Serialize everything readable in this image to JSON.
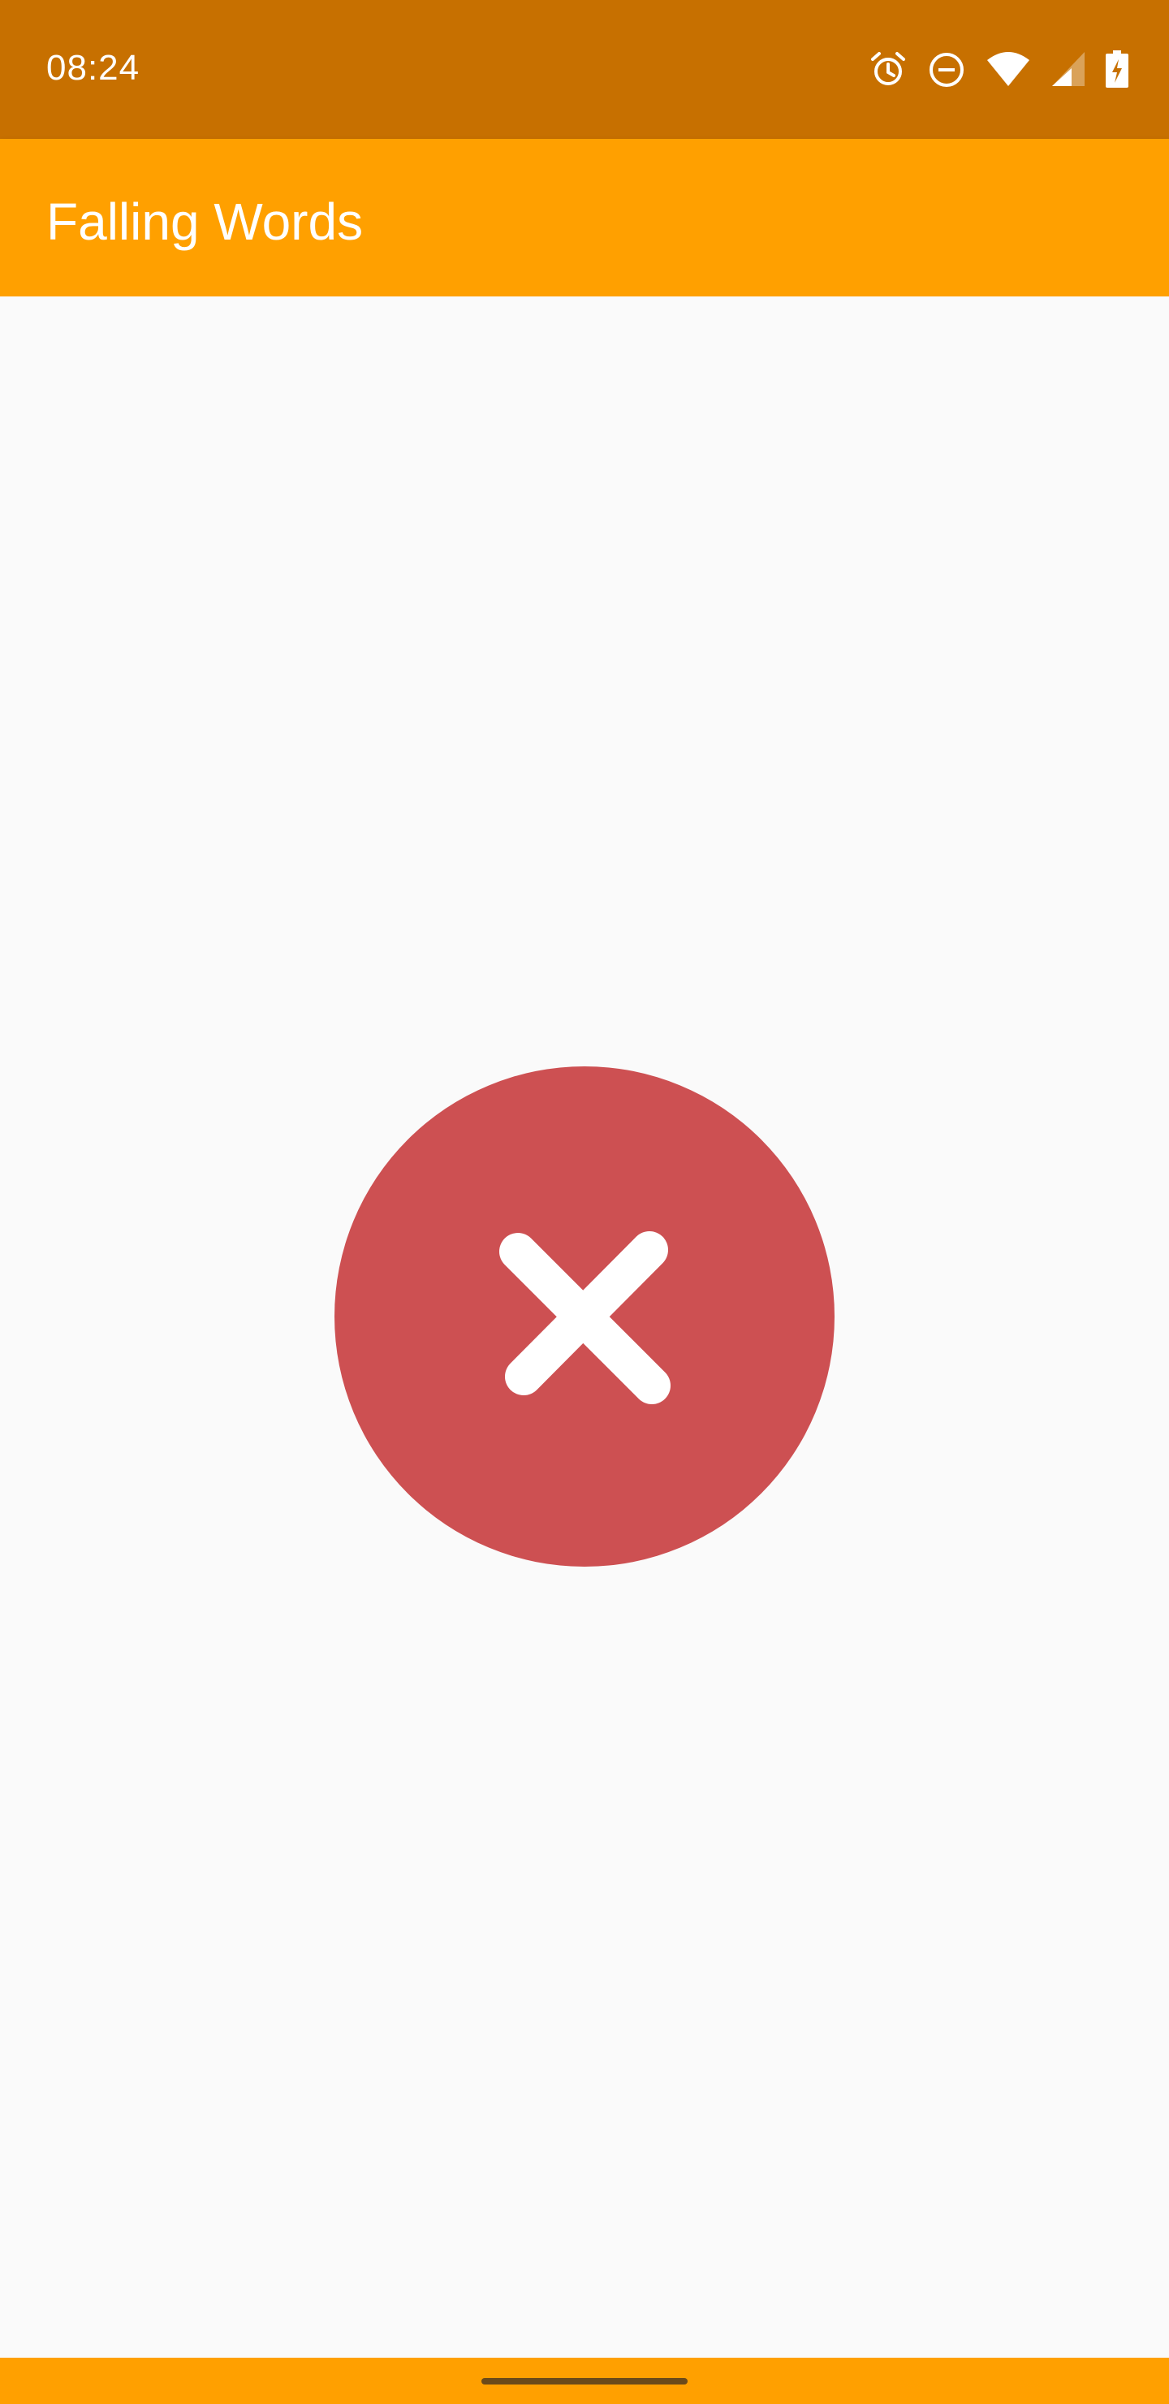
{
  "status_bar": {
    "time": "08:24",
    "background": "#C77000",
    "icons": [
      "alarm-icon",
      "do-not-disturb-icon",
      "wifi-icon",
      "cell-signal-icon",
      "battery-charging-icon"
    ]
  },
  "app_bar": {
    "title": "Falling Words",
    "background": "#FFA000"
  },
  "result": {
    "state": "incorrect",
    "icon": "close-icon",
    "circle_color": "#CD5052",
    "icon_color": "#FFFFFF"
  },
  "nav_bar": {
    "background": "#FFA000"
  }
}
